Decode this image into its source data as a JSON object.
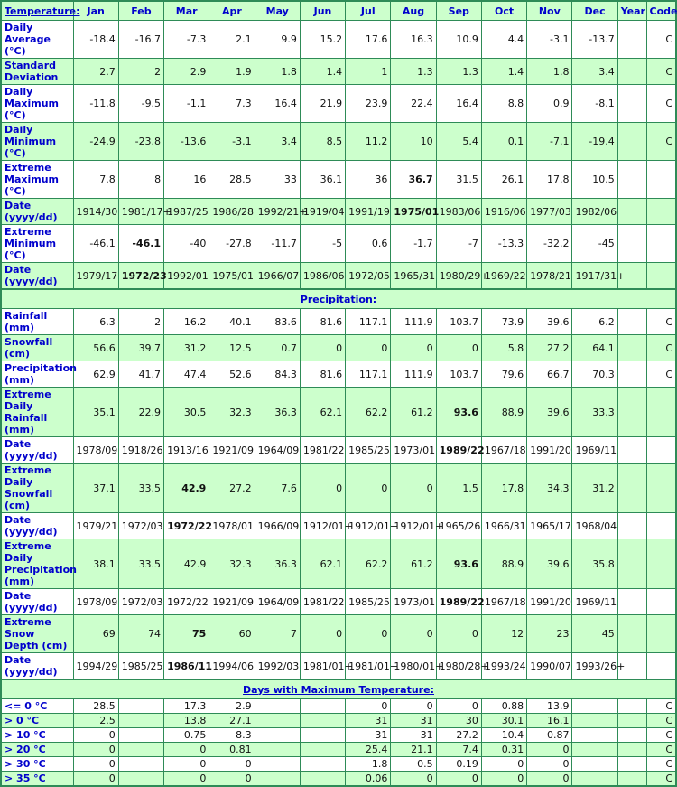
{
  "table": {
    "columns": [
      "Jan",
      "Feb",
      "Mar",
      "Apr",
      "May",
      "Jun",
      "Jul",
      "Aug",
      "Sep",
      "Oct",
      "Nov",
      "Dec",
      "Year",
      "Code"
    ],
    "sections": [
      {
        "title": "Temperature:",
        "rows": [
          {
            "label": "Daily Average (°C)",
            "values": [
              "-18.4",
              "-16.7",
              "-7.3",
              "2.1",
              "9.9",
              "15.2",
              "17.6",
              "16.3",
              "10.9",
              "4.4",
              "-3.1",
              "-13.7",
              "",
              "C"
            ],
            "bold": []
          },
          {
            "label": "Standard Deviation",
            "values": [
              "2.7",
              "2",
              "2.9",
              "1.9",
              "1.8",
              "1.4",
              "1",
              "1.3",
              "1.3",
              "1.4",
              "1.8",
              "3.4",
              "",
              "C"
            ],
            "bold": []
          },
          {
            "label": "Daily Maximum (°C)",
            "values": [
              "-11.8",
              "-9.5",
              "-1.1",
              "7.3",
              "16.4",
              "21.9",
              "23.9",
              "22.4",
              "16.4",
              "8.8",
              "0.9",
              "-8.1",
              "",
              "C"
            ],
            "bold": []
          },
          {
            "label": "Daily Minimum (°C)",
            "values": [
              "-24.9",
              "-23.8",
              "-13.6",
              "-3.1",
              "3.4",
              "8.5",
              "11.2",
              "10",
              "5.4",
              "0.1",
              "-7.1",
              "-19.4",
              "",
              "C"
            ],
            "bold": []
          },
          {
            "label": "Extreme Maximum (°C)",
            "values": [
              "7.8",
              "8",
              "16",
              "28.5",
              "33",
              "36.1",
              "36",
              "36.7",
              "31.5",
              "26.1",
              "17.8",
              "10.5",
              "",
              ""
            ],
            "bold": [
              7
            ]
          },
          {
            "label": "Date (yyyy/dd)",
            "values": [
              "1914/30",
              "1981/17+",
              "1987/25",
              "1986/28",
              "1992/21+",
              "1919/04",
              "1991/19",
              "1975/01",
              "1983/06",
              "1916/06",
              "1977/03",
              "1982/06",
              "",
              ""
            ],
            "bold": [
              7
            ]
          },
          {
            "label": "Extreme Minimum (°C)",
            "values": [
              "-46.1",
              "-46.1",
              "-40",
              "-27.8",
              "-11.7",
              "-5",
              "0.6",
              "-1.7",
              "-7",
              "-13.3",
              "-32.2",
              "-45",
              "",
              ""
            ],
            "bold": [
              1
            ]
          },
          {
            "label": "Date (yyyy/dd)",
            "values": [
              "1979/17",
              "1972/23",
              "1992/01",
              "1975/01",
              "1966/07",
              "1986/06",
              "1972/05",
              "1965/31",
              "1980/29+",
              "1969/22",
              "1978/21",
              "1917/31+",
              "",
              ""
            ],
            "bold": [
              1
            ]
          }
        ]
      },
      {
        "title": "Precipitation:",
        "rows": [
          {
            "label": "Rainfall (mm)",
            "values": [
              "6.3",
              "2",
              "16.2",
              "40.1",
              "83.6",
              "81.6",
              "117.1",
              "111.9",
              "103.7",
              "73.9",
              "39.6",
              "6.2",
              "",
              "C"
            ],
            "bold": []
          },
          {
            "label": "Snowfall (cm)",
            "values": [
              "56.6",
              "39.7",
              "31.2",
              "12.5",
              "0.7",
              "0",
              "0",
              "0",
              "0",
              "5.8",
              "27.2",
              "64.1",
              "",
              "C"
            ],
            "bold": []
          },
          {
            "label": "Precipitation (mm)",
            "values": [
              "62.9",
              "41.7",
              "47.4",
              "52.6",
              "84.3",
              "81.6",
              "117.1",
              "111.9",
              "103.7",
              "79.6",
              "66.7",
              "70.3",
              "",
              "C"
            ],
            "bold": []
          },
          {
            "label": "Extreme Daily Rainfall (mm)",
            "values": [
              "35.1",
              "22.9",
              "30.5",
              "32.3",
              "36.3",
              "62.1",
              "62.2",
              "61.2",
              "93.6",
              "88.9",
              "39.6",
              "33.3",
              "",
              ""
            ],
            "bold": [
              8
            ]
          },
          {
            "label": "Date (yyyy/dd)",
            "values": [
              "1978/09",
              "1918/26",
              "1913/16",
              "1921/09",
              "1964/09",
              "1981/22",
              "1985/25",
              "1973/01",
              "1989/22",
              "1967/18",
              "1991/20",
              "1969/11",
              "",
              ""
            ],
            "bold": [
              8
            ]
          },
          {
            "label": "Extreme Daily Snowfall (cm)",
            "values": [
              "37.1",
              "33.5",
              "42.9",
              "27.2",
              "7.6",
              "0",
              "0",
              "0",
              "1.5",
              "17.8",
              "34.3",
              "31.2",
              "",
              ""
            ],
            "bold": [
              2
            ]
          },
          {
            "label": "Date (yyyy/dd)",
            "values": [
              "1979/21",
              "1972/03",
              "1972/22",
              "1978/01",
              "1966/09",
              "1912/01+",
              "1912/01+",
              "1912/01+",
              "1965/26",
              "1966/31",
              "1965/17",
              "1968/04",
              "",
              ""
            ],
            "bold": [
              2
            ]
          },
          {
            "label": "Extreme Daily Precipitation (mm)",
            "values": [
              "38.1",
              "33.5",
              "42.9",
              "32.3",
              "36.3",
              "62.1",
              "62.2",
              "61.2",
              "93.6",
              "88.9",
              "39.6",
              "35.8",
              "",
              ""
            ],
            "bold": [
              8
            ]
          },
          {
            "label": "Date (yyyy/dd)",
            "values": [
              "1978/09",
              "1972/03",
              "1972/22",
              "1921/09",
              "1964/09",
              "1981/22",
              "1985/25",
              "1973/01",
              "1989/22",
              "1967/18",
              "1991/20",
              "1969/11",
              "",
              ""
            ],
            "bold": [
              8
            ]
          },
          {
            "label": "Extreme Snow Depth (cm)",
            "values": [
              "69",
              "74",
              "75",
              "60",
              "7",
              "0",
              "0",
              "0",
              "0",
              "12",
              "23",
              "45",
              "",
              ""
            ],
            "bold": [
              2
            ]
          },
          {
            "label": "Date (yyyy/dd)",
            "values": [
              "1994/29",
              "1985/25",
              "1986/11",
              "1994/06",
              "1992/03",
              "1981/01+",
              "1981/01+",
              "1980/01+",
              "1980/28+",
              "1993/24",
              "1990/07",
              "1993/26+",
              "",
              ""
            ],
            "bold": [
              2
            ]
          }
        ]
      },
      {
        "title": "Days with Maximum Temperature:",
        "rows": [
          {
            "label": "<= 0 °C",
            "values": [
              "28.5",
              "",
              "17.3",
              "2.9",
              "",
              "",
              "0",
              "0",
              "0",
              "0.88",
              "13.9",
              "",
              "",
              "C"
            ],
            "bold": []
          },
          {
            "label": "> 0 °C",
            "values": [
              "2.5",
              "",
              "13.8",
              "27.1",
              "",
              "",
              "31",
              "31",
              "30",
              "30.1",
              "16.1",
              "",
              "",
              "C"
            ],
            "bold": []
          },
          {
            "label": "> 10 °C",
            "values": [
              "0",
              "",
              "0.75",
              "8.3",
              "",
              "",
              "31",
              "31",
              "27.2",
              "10.4",
              "0.87",
              "",
              "",
              "C"
            ],
            "bold": []
          },
          {
            "label": "> 20 °C",
            "values": [
              "0",
              "",
              "0",
              "0.81",
              "",
              "",
              "25.4",
              "21.1",
              "7.4",
              "0.31",
              "0",
              "",
              "",
              "C"
            ],
            "bold": []
          },
          {
            "label": "> 30 °C",
            "values": [
              "0",
              "",
              "0",
              "0",
              "",
              "",
              "1.8",
              "0.5",
              "0.19",
              "0",
              "0",
              "",
              "",
              "C"
            ],
            "bold": []
          },
          {
            "label": "> 35 °C",
            "values": [
              "0",
              "",
              "0",
              "0",
              "",
              "",
              "0.06",
              "0",
              "0",
              "0",
              "0",
              "",
              "",
              "C"
            ],
            "bold": []
          }
        ]
      }
    ]
  }
}
